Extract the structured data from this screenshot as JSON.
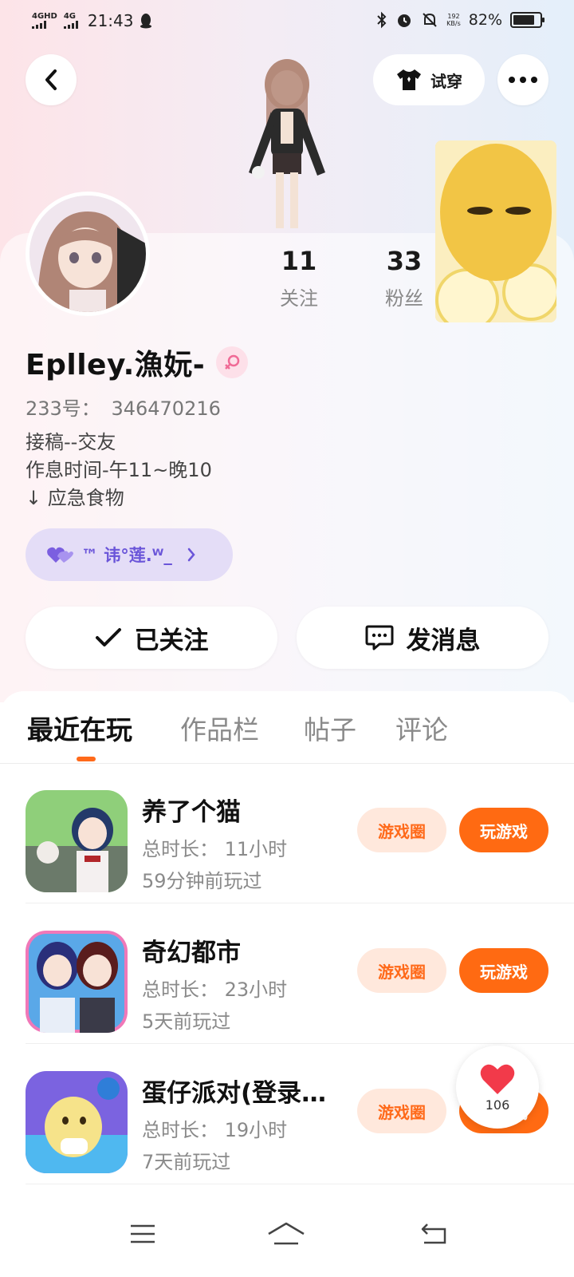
{
  "status_bar": {
    "network_1": "4GHD",
    "network_2": "4G",
    "time": "21:43",
    "speed_value": "192",
    "speed_unit": "KB/s",
    "battery_percent": "82%",
    "battery_level": 0.82
  },
  "header": {
    "back_icon": "chevron-left-icon",
    "tryon_label": "试穿",
    "more_icon": "more-dots-icon"
  },
  "profile": {
    "following_count": "11",
    "following_label": "关注",
    "fans_count": "33",
    "fans_label": "粉丝",
    "username": "Eplley.漁妧-",
    "gender_icon": "female-icon",
    "uid_label": "233号：",
    "uid_value": "346470216",
    "bio_lines": [
      "接稿--交友",
      "作息时间-午11~晚10",
      "↓ 应急食物"
    ],
    "badge_text": "™ 讳°莲.ᵂ_",
    "followed_label": "已关注",
    "message_label": "发消息"
  },
  "tabs": [
    {
      "label": "最近在玩",
      "active": true
    },
    {
      "label": "作品栏",
      "active": false
    },
    {
      "label": "帖子",
      "active": false
    },
    {
      "label": "评论",
      "active": false
    }
  ],
  "games": [
    {
      "name": "养了个猫",
      "duration": "总时长：  11小时",
      "last_played": "59分钟前玩过",
      "circle_label": "游戏圈",
      "play_label": "玩游戏"
    },
    {
      "name": "奇幻都市",
      "duration": "总时长：  23小时",
      "last_played": "5天前玩过",
      "circle_label": "游戏圈",
      "play_label": "玩游戏"
    },
    {
      "name": "蛋仔派对(登录…",
      "duration": "总时长：  19小时",
      "last_played": "7天前玩过",
      "circle_label": "游戏圈",
      "play_label": "玩游戏"
    }
  ],
  "like": {
    "count": "106"
  },
  "colors": {
    "accent": "#ff6a12",
    "accent_light": "#ffe8dc",
    "badge_bg": "#e4ddf7",
    "badge_text": "#6a55d9"
  },
  "nav_icons": [
    "menu-icon",
    "home-icon",
    "back-icon"
  ]
}
